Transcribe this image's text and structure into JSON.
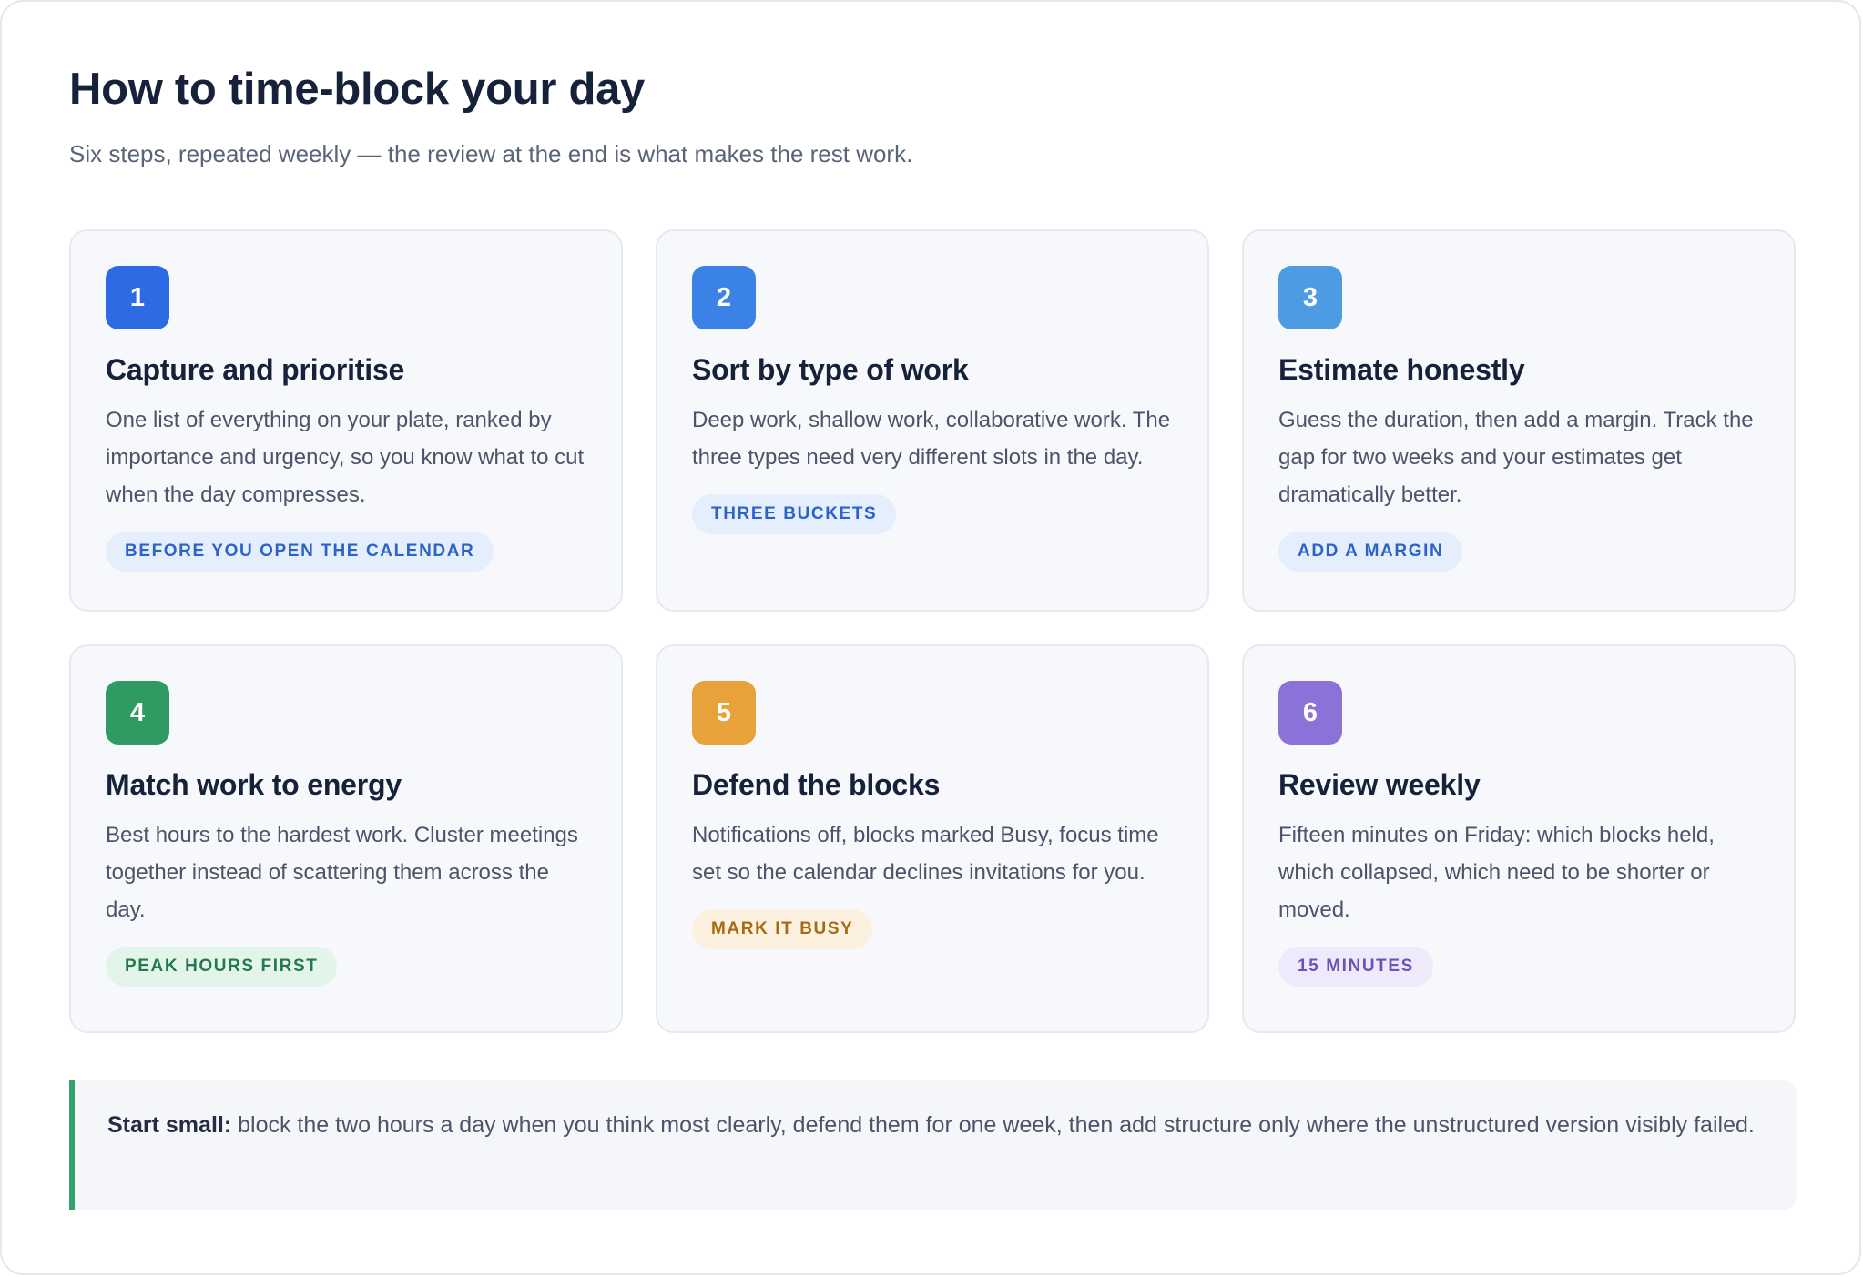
{
  "header": {
    "title": "How to time-block your day",
    "subtitle": "Six steps, repeated weekly — the review at the end is what makes the rest work."
  },
  "steps": [
    {
      "number": "1",
      "title": "Capture and prioritise",
      "body": "One list of everything on your plate, ranked by importance and urgency, so you know what to cut when the day compresses.",
      "tag": "BEFORE YOU OPEN THE CALENDAR",
      "colors": {
        "badge": "#2d6be4",
        "tag_bg": "#e5eefc",
        "tag_text": "#2c63c9"
      }
    },
    {
      "number": "2",
      "title": "Sort by type of work",
      "body": "Deep work, shallow work, collaborative work. The three types need very different slots in the day.",
      "tag": "THREE BUCKETS",
      "colors": {
        "badge": "#3b82e6",
        "tag_bg": "#e5eefc",
        "tag_text": "#2c63c9"
      }
    },
    {
      "number": "3",
      "title": "Estimate honestly",
      "body": "Guess the duration, then add a margin. Track the gap for two weeks and your estimates get dramatically better.",
      "tag": "ADD A MARGIN",
      "colors": {
        "badge": "#4c9be3",
        "tag_bg": "#e5eefc",
        "tag_text": "#2c63c9"
      }
    },
    {
      "number": "4",
      "title": "Match work to energy",
      "body": "Best hours to the hardest work. Cluster meetings together instead of scattering them across the day.",
      "tag": "PEAK HOURS FIRST",
      "colors": {
        "badge": "#2f9a62",
        "tag_bg": "#e3f4ea",
        "tag_text": "#237a4c"
      }
    },
    {
      "number": "5",
      "title": "Defend the blocks",
      "body": "Notifications off, blocks marked Busy, focus time set so the calendar declines invitations for you.",
      "tag": "MARK IT BUSY",
      "colors": {
        "badge": "#e8a23b",
        "tag_bg": "#fcf0de",
        "tag_text": "#a66a14"
      }
    },
    {
      "number": "6",
      "title": "Review weekly",
      "body": "Fifteen minutes on Friday: which blocks held, which collapsed, which need to be shorter or moved.",
      "tag": "15 MINUTES",
      "colors": {
        "badge": "#8b72d8",
        "tag_bg": "#eeeafb",
        "tag_text": "#6a52b8"
      }
    }
  ],
  "note": {
    "lead": "Start small:",
    "text": " block the two hours a day when you think most clearly, defend them for one week, then add structure only where the unstructured version visibly failed."
  }
}
